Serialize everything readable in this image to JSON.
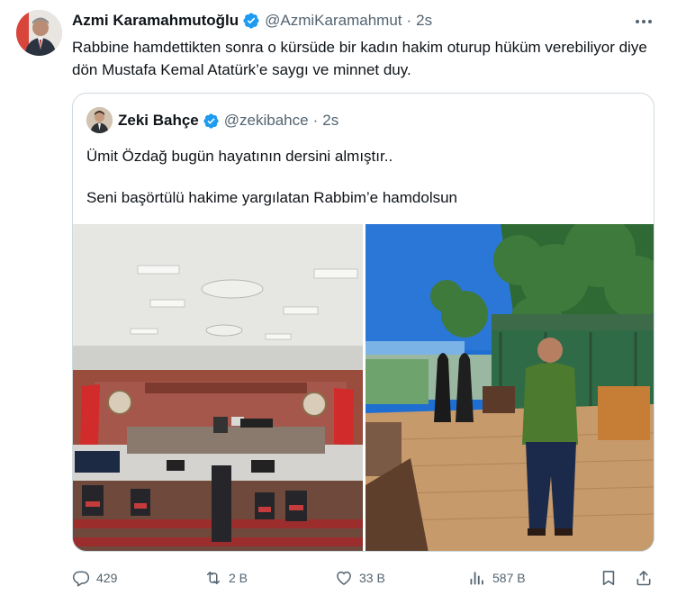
{
  "tweet": {
    "author_name": "Azmi Karamahmutoğlu",
    "author_handle": "@AzmiKaramahmut",
    "separator": "·",
    "time": "2s",
    "text": "Rabbine hamdettikten sonra o kürsüde bir kadın hakim oturup hüküm verebiliyor diye dön Mustafa Kemal Atatürk’e saygı ve minnet duy.",
    "verified_color": "#1d9bf0"
  },
  "quoted": {
    "author_name": "Zeki Bahçe",
    "author_handle": "@zekibahce",
    "separator": "·",
    "time": "2s",
    "text_line1": "Ümit Özdağ bugün hayatının dersini almıştır..",
    "text_line2": "Seni başörtülü hakime yargılatan Rabbim’e hamdolsun"
  },
  "actions": {
    "replies": "429",
    "reposts": "2 B",
    "likes": "33 B",
    "views": "587 B"
  },
  "icons": {
    "more": "more-horizontal-icon",
    "reply": "reply-icon",
    "repost": "repost-icon",
    "like": "heart-icon",
    "views": "views-icon",
    "bookmark": "bookmark-icon",
    "share": "share-icon",
    "verified": "verified-badge-icon"
  }
}
